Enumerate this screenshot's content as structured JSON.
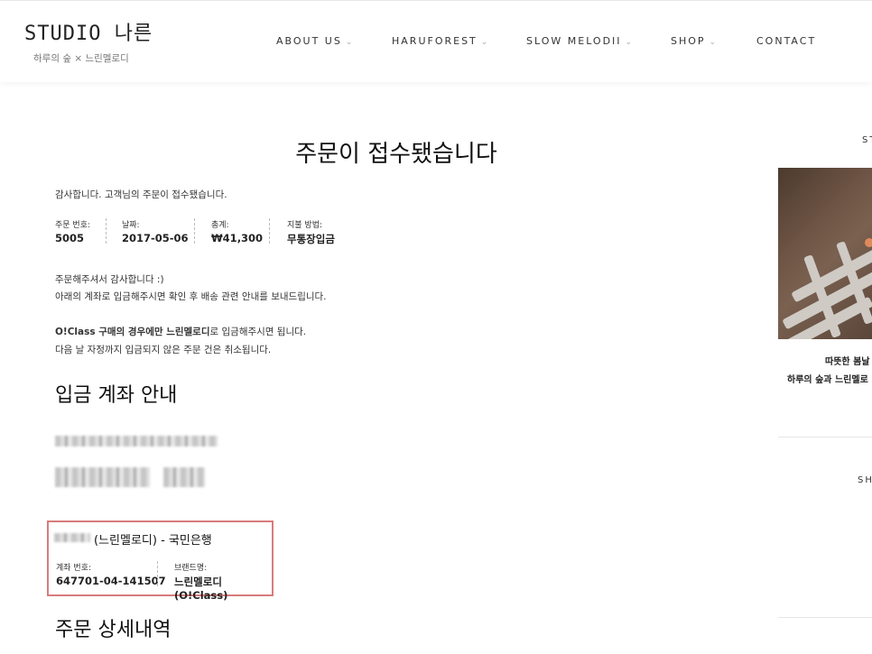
{
  "header": {
    "logo_title": "STUDIO 나른",
    "logo_subtitle": "하루의 숲 × 느린멜로디",
    "nav": [
      {
        "label": "ABOUT US",
        "chevron": "⌄"
      },
      {
        "label": "HARUFOREST",
        "chevron": "⌄"
      },
      {
        "label": "SLOW MELODII",
        "chevron": "⌄"
      },
      {
        "label": "SHOP",
        "chevron": "⌄"
      },
      {
        "label": "CONTACT",
        "chevron": ""
      }
    ]
  },
  "order": {
    "title": "주문이 접수됐습니다",
    "thanks": "감사합니다. 고객님의 주문이 접수됐습니다.",
    "meta": [
      {
        "label": "주문 번호:",
        "value": "5005"
      },
      {
        "label": "날짜:",
        "value": "2017-05-06"
      },
      {
        "label": "총계:",
        "value": "₩41,300"
      },
      {
        "label": "지불 방법:",
        "value": "무통장입금"
      }
    ],
    "note1": "주문해주셔서 감사합니다 :)",
    "note2": "아래의 계좌로 입금해주시면 확인 후 배송 관련 안내를 보내드립니다.",
    "note3_bold": "O!Class 구매의 경우에만 느린멜로디",
    "note3_rest": "로 입금해주시면 됩니다.",
    "note4": "다음 날 자정까지 입금되지 않은 주문 건은 취소됩니다."
  },
  "bank": {
    "section_title": "입금 계좌 안내",
    "line": "(느린멜로디) - 국민은행",
    "account_label": "계좌 번호:",
    "account_value": "647701-04-141507",
    "brand_label": "브랜드명:",
    "brand_value": "느린멜로디 (O!Class)"
  },
  "details": {
    "section_title": "주문 상세내역"
  },
  "sidebar": {
    "top_label": "ST",
    "caption1": "따뜻한 봄날",
    "caption2": "하루의 숲과 느린멜로",
    "bottom_label": "SH"
  }
}
